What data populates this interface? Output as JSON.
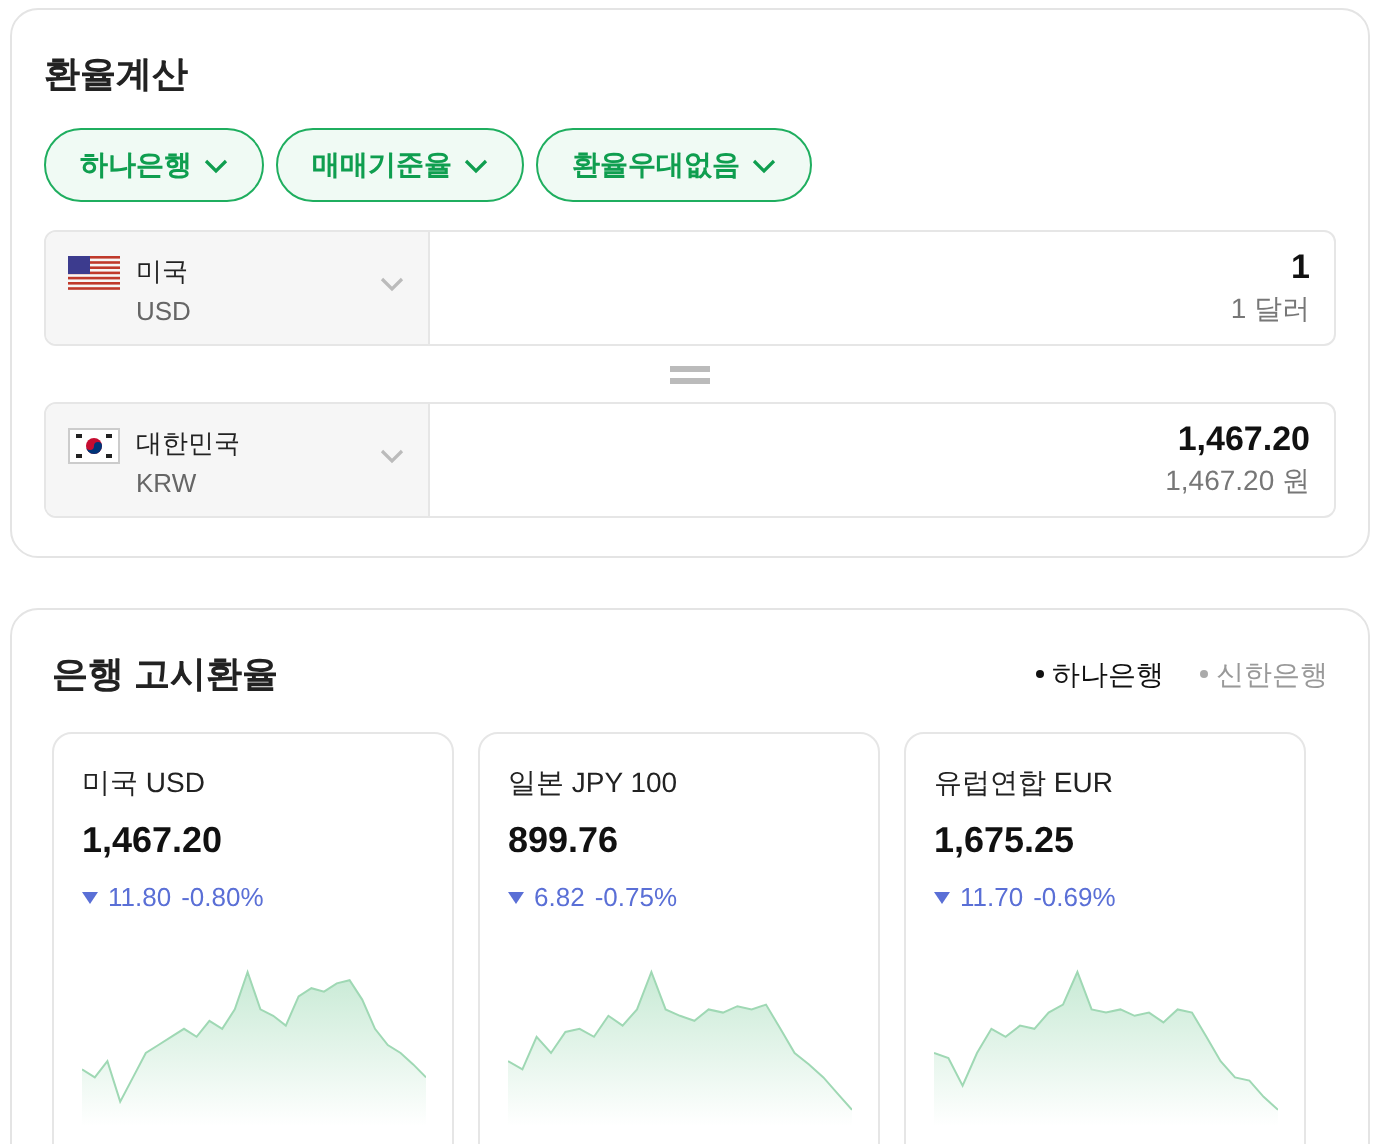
{
  "calculator": {
    "title": "환율계산",
    "filters": [
      {
        "label": "하나은행"
      },
      {
        "label": "매매기준율"
      },
      {
        "label": "환율우대없음"
      }
    ],
    "rows": [
      {
        "kind": "us",
        "country": "미국",
        "code": "USD",
        "amount": "1",
        "amount_text": "1 달러"
      },
      {
        "kind": "kr",
        "country": "대한민국",
        "code": "KRW",
        "amount": "1,467.20",
        "amount_text": "1,467.20 원"
      }
    ]
  },
  "rates": {
    "title": "은행 고시환율",
    "banks": [
      {
        "label": "하나은행",
        "selected": true
      },
      {
        "label": "신한은행",
        "selected": false
      }
    ],
    "cards": [
      {
        "name": "미국 USD",
        "rate": "1,467.20",
        "change": "11.80",
        "percent": "-0.80%",
        "kind": "down"
      },
      {
        "name": "일본 JPY 100",
        "rate": "899.76",
        "change": "6.82",
        "percent": "-0.75%",
        "kind": "down"
      },
      {
        "name": "유럽연합 EUR",
        "rate": "1,675.25",
        "change": "11.70",
        "percent": "-0.69%",
        "kind": "down"
      }
    ]
  }
}
